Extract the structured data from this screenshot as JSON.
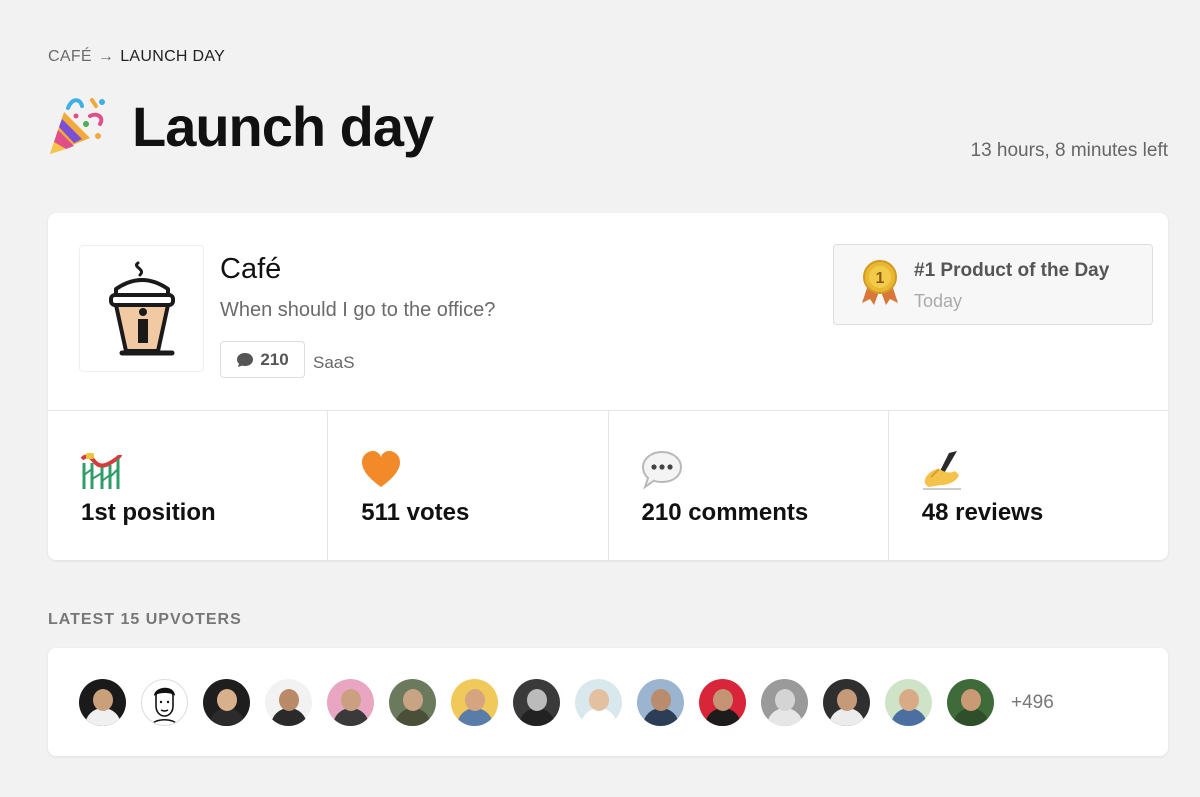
{
  "breadcrumb": {
    "parent": "CAFÉ",
    "separator": "→",
    "current": "LAUNCH DAY"
  },
  "header": {
    "title": "Launch day",
    "icon": "party-popper-icon",
    "time_left": "13 hours, 8 minutes left"
  },
  "product": {
    "name": "Café",
    "tagline": "When should I go to the office?",
    "comment_count": "210",
    "tag": "SaaS",
    "award": {
      "title": "#1 Product of the Day",
      "subtitle": "Today",
      "medal_number": "1"
    }
  },
  "stats": [
    {
      "icon": "roller-coaster-icon",
      "label": "1st position"
    },
    {
      "icon": "orange-heart-icon",
      "label": "511 votes"
    },
    {
      "icon": "speech-bubble-icon",
      "label": "210 comments"
    },
    {
      "icon": "writing-hand-icon",
      "label": "48 reviews"
    }
  ],
  "upvoters": {
    "section_label": "LATEST 15 UPVOTERS",
    "more": "+496",
    "avatars": [
      {
        "bg": "#1a1a1a",
        "skin": "#c9a07a",
        "shirt": "#f0f0f0"
      },
      {
        "bg": "#ffffff",
        "skin": "#ffffff",
        "shirt": "#ffffff"
      },
      {
        "bg": "#1e1e1e",
        "skin": "#d9b08c",
        "shirt": "#2b2b2b"
      },
      {
        "bg": "#f2f2f2",
        "skin": "#b88a68",
        "shirt": "#2a2a2a"
      },
      {
        "bg": "#e9a6c2",
        "skin": "#caa080",
        "shirt": "#3a3a3a"
      },
      {
        "bg": "#6b7a5d",
        "skin": "#c8a384",
        "shirt": "#4a4f3a"
      },
      {
        "bg": "#f0c95a",
        "skin": "#d6a57f",
        "shirt": "#5a7ca8"
      },
      {
        "bg": "#3a3a3a",
        "skin": "#bbbbbb",
        "shirt": "#222222"
      },
      {
        "bg": "#d9e8ec",
        "skin": "#e2c0a0",
        "shirt": "#ffffff"
      },
      {
        "bg": "#9bb5d0",
        "skin": "#b88c6c",
        "shirt": "#2c3e55"
      },
      {
        "bg": "#d8253a",
        "skin": "#c59474",
        "shirt": "#1c1c1c"
      },
      {
        "bg": "#9a9a9a",
        "skin": "#d4d4d4",
        "shirt": "#e6e6e6"
      },
      {
        "bg": "#2f2f2f",
        "skin": "#c49a78",
        "shirt": "#ececec"
      },
      {
        "bg": "#cfe3c9",
        "skin": "#d8ab86",
        "shirt": "#4a6fa0"
      },
      {
        "bg": "#3f6b3a",
        "skin": "#c99a74",
        "shirt": "#2f4f2a"
      }
    ]
  },
  "colors": {
    "background": "#f2f2f2",
    "card": "#ffffff",
    "heart": "#f38a2a",
    "medal": "#e8b832"
  }
}
